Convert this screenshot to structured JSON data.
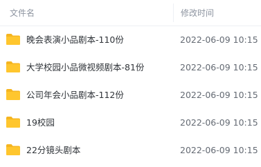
{
  "header": {
    "name_label": "文件名",
    "time_label": "修改时间"
  },
  "colors": {
    "folder": "#FFC62E",
    "folder_tab": "#F5B520",
    "header_text": "#8D94A0",
    "name_text": "#2F3338",
    "time_text": "#646A73"
  },
  "rows": [
    {
      "icon": "folder-icon",
      "name": "晚会表演小品剧本-110份",
      "time": "2022-06-09 10:15"
    },
    {
      "icon": "folder-icon",
      "name": "大学校园小品微视频剧本-81份",
      "time": "2022-06-09 10:15"
    },
    {
      "icon": "folder-icon",
      "name": "公司年会小品剧本-112份",
      "time": "2022-06-09 10:15"
    },
    {
      "icon": "folder-icon",
      "name": "19校园",
      "time": "2022-06-09 10:15"
    },
    {
      "icon": "folder-icon",
      "name": "22分镜头剧本",
      "time": "2022-06-09 10:15"
    }
  ]
}
